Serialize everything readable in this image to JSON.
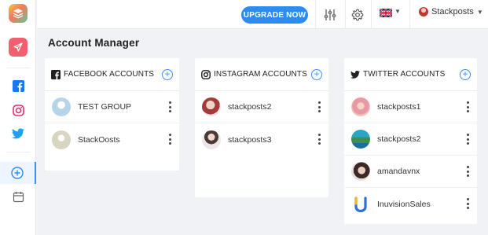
{
  "app": {
    "icons": {
      "logo": "layers-icon",
      "send": "paper-plane-icon"
    },
    "colors": {
      "accent": "#2d8cf0",
      "send_bg": "#f2606f",
      "facebook": "#1877f2",
      "instagram": "#d6336c",
      "twitter": "#1da1f2"
    }
  },
  "sidebar": {
    "items": [
      {
        "name": "send",
        "icon": "paper-plane-icon"
      },
      {
        "name": "facebook",
        "icon": "facebook-icon"
      },
      {
        "name": "instagram",
        "icon": "instagram-icon"
      },
      {
        "name": "twitter",
        "icon": "twitter-icon"
      },
      {
        "name": "add",
        "icon": "plus-circle-icon",
        "active": true
      },
      {
        "name": "calendar",
        "icon": "calendar-icon"
      }
    ]
  },
  "header": {
    "upgrade_label": "UPGRADE NOW",
    "language_icon": "uk-flag-icon",
    "user_name": "Stackposts"
  },
  "page": {
    "title": "Account Manager"
  },
  "cards": {
    "facebook": {
      "title": "FACEBOOK ACCOUNTS",
      "accounts": [
        {
          "name": "TEST GROUP"
        },
        {
          "name": "StackOosts"
        }
      ]
    },
    "instagram": {
      "title": "INSTAGRAM ACCOUNTS",
      "accounts": [
        {
          "name": "stackposts2"
        },
        {
          "name": "stackposts3"
        }
      ]
    },
    "twitter": {
      "title": "TWITTER ACCOUNTS",
      "accounts": [
        {
          "name": "stackposts1"
        },
        {
          "name": "stackposts2"
        },
        {
          "name": "amandavnx"
        },
        {
          "name": "InuvisionSales"
        }
      ]
    }
  }
}
